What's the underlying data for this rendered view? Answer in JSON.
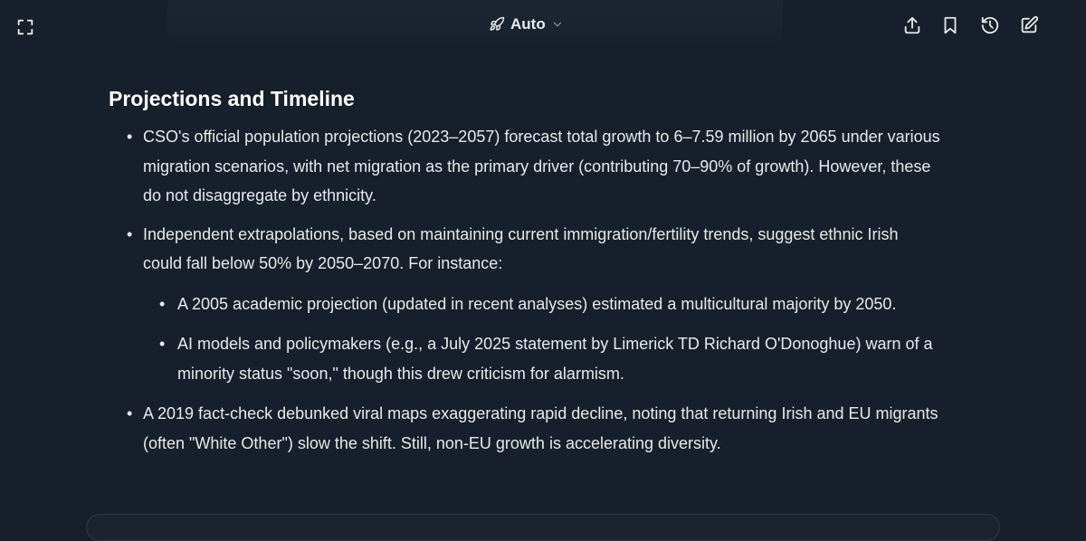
{
  "header": {
    "model": {
      "label": "Auto",
      "icon": "rocket-icon"
    },
    "actions": [
      "share-icon",
      "bookmark-icon",
      "history-icon",
      "edit-icon"
    ]
  },
  "content": {
    "title": "Projections and Timeline",
    "bullets": [
      {
        "text": "CSO's official population projections (2023–2057) forecast total growth to 6–7.59 million by 2065 under various migration scenarios, with net migration as the primary driver (contributing 70–90% of growth). However, these do not disaggregate by ethnicity."
      },
      {
        "text": "Independent extrapolations, based on maintaining current immigration/fertility trends, suggest ethnic Irish could fall below 50% by 2050–2070. For instance:",
        "sub": [
          "A 2005 academic projection (updated in recent analyses) estimated a multicultural majority by 2050.",
          "AI models and policymakers (e.g., a July 2025 statement by Limerick TD Richard O'Donoghue) warn of a minority status \"soon,\" though this drew criticism for alarmism."
        ]
      },
      {
        "text": "A 2019 fact-check debunked viral maps exaggerating rapid decline, noting that returning Irish and EU migrants (often \"White Other\") slow the shift. Still, non-EU growth is accelerating diversity."
      }
    ]
  }
}
